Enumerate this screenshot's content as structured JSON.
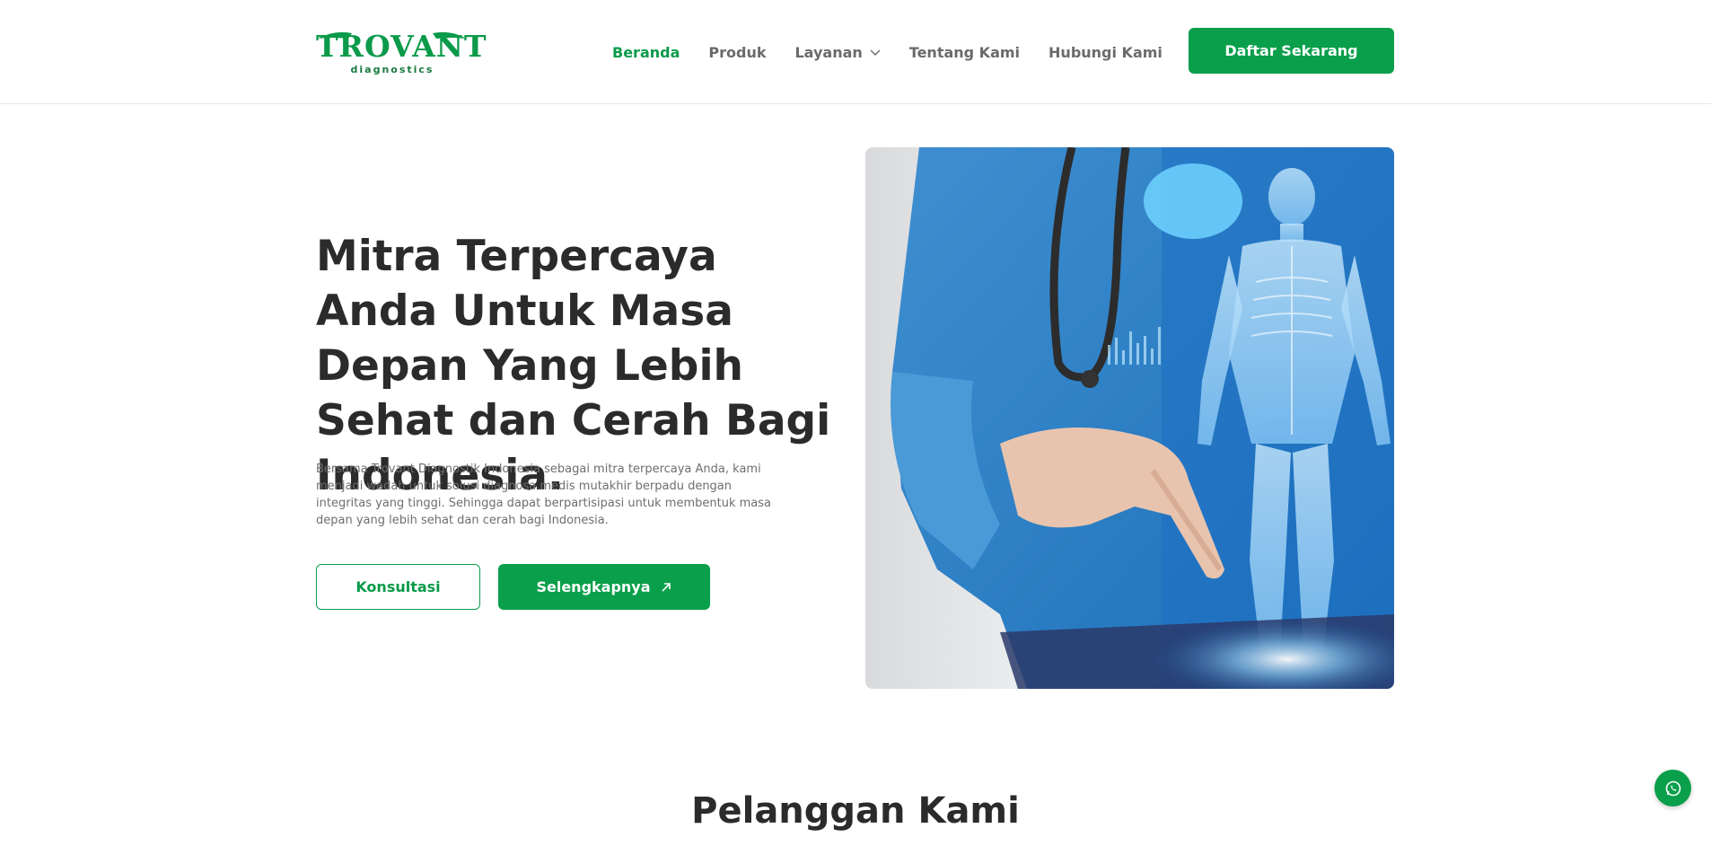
{
  "brand": {
    "name": "TROVANT",
    "tagline": "diagnostics",
    "color": "#0a9a4a"
  },
  "nav": {
    "items": [
      {
        "label": "Beranda",
        "active": true
      },
      {
        "label": "Produk",
        "active": false
      },
      {
        "label": "Layanan",
        "active": false,
        "dropdown": true
      },
      {
        "label": "Tentang Kami",
        "active": false
      },
      {
        "label": "Hubungi Kami",
        "active": false
      }
    ],
    "cta_label": "Daftar Sekarang"
  },
  "hero": {
    "title": "Mitra Terpercaya Anda Untuk Masa Depan Yang Lebih Sehat dan Cerah Bagi Indonesia.",
    "description": "Bersama Trovant Diagnostik Indonesia sebagai mitra terpercaya Anda, kami menjadi wadah untuk solusi diagnosa medis mutakhir berpadu dengan integritas yang tinggi. Sehingga dapat berpartisipasi untuk membentuk masa depan yang lebih sehat dan cerah bagi Indonesia.",
    "primary_button": "Konsultasi",
    "secondary_button": "Selengkapnya"
  },
  "customers": {
    "title": "Pelanggan Kami"
  },
  "icons": {
    "dropdown": "chevron-down-icon",
    "external": "arrow-up-right-icon",
    "whatsapp": "whatsapp-icon"
  },
  "colors": {
    "primary": "#0a9f4b",
    "text": "#2b2b2b",
    "muted": "#6e6e6e"
  }
}
